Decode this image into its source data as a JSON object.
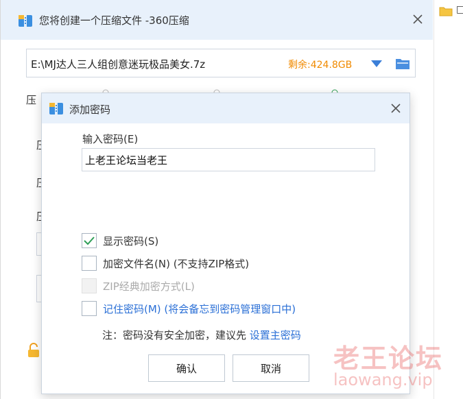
{
  "main_window": {
    "title": "您将创建一个压缩文件 -360压缩",
    "path": "E:\\MJ达人三人组创意迷玩极品美女.7z",
    "free_space": "剩余:424.8GB",
    "label_compress": "压",
    "label_row1": "压",
    "label_row2": "压",
    "label_row3": "压"
  },
  "dialog": {
    "title": "添加密码",
    "password_label": "输入密码(E)",
    "password_value": "上老王论坛当老王",
    "show_password_label": "显示密码(S)",
    "encrypt_names_label": "加密文件名(N) (不支持ZIP格式)",
    "zip_classic_label": "ZIP经典加密方式(L)",
    "remember_label": "记住密码(M) (将会备忘到密码管理窗口中)",
    "note_text": "注：密码没有安全加密，建议先 ",
    "note_link": "设置主密码",
    "ok_label": "确认",
    "cancel_label": "取消"
  },
  "watermark": {
    "text": "老王论坛",
    "url": "laowang.vip"
  },
  "colors": {
    "titlebar_bg": "#e8f1fb",
    "accent_blue": "#2a6fd6",
    "free_space_orange": "#f08a00",
    "check_green": "#2e9e56"
  },
  "icons": {
    "app": "archive-icon",
    "close": "close-icon",
    "dropdown": "triangle-down-icon",
    "folder": "folder-icon",
    "lock": "lock-icon",
    "check": "check-icon"
  }
}
